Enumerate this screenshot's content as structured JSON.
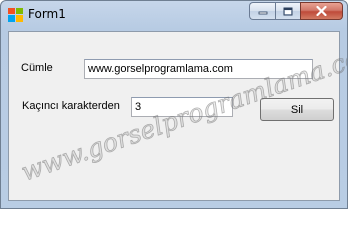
{
  "window": {
    "title": "Form1"
  },
  "form": {
    "sentence_label": "Cümle",
    "sentence_value": "www.gorselprogramlama.com",
    "char_label": "Kaçıncı karakterden",
    "char_value": "3",
    "delete_button": "Sil"
  },
  "watermark": {
    "text": "www.gorselprogramlama.com"
  },
  "colors": {
    "close_button": "#c75a48",
    "client_background": "#f0f0f0",
    "frame": "#b9cde4"
  },
  "icons": {
    "app": "windows-form-icon",
    "minimize": "minimize-icon",
    "maximize": "maximize-icon",
    "close": "close-icon"
  }
}
